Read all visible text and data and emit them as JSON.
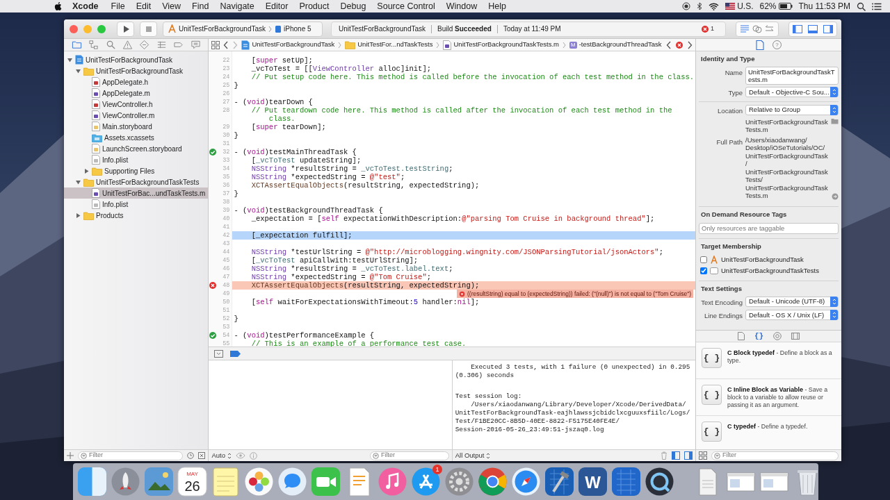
{
  "menu_bar": {
    "app": "Xcode",
    "menus": [
      "File",
      "Edit",
      "View",
      "Find",
      "Navigate",
      "Editor",
      "Product",
      "Debug",
      "Source Control",
      "Window",
      "Help"
    ],
    "input_source": "U.S.",
    "battery": "62%",
    "clock": "Thu 11:53 PM"
  },
  "toolbar": {
    "scheme": "UnitTestForBackgroundTask",
    "device": "iPhone 5",
    "activity": {
      "project": "UnitTestForBackgroundTask",
      "status": "Build **Succeeded**",
      "time": "Today at 11:49 PM",
      "errors": "1"
    },
    "editor_modes": [
      {
        "kind": "standard",
        "selected": true
      },
      {
        "kind": "assistant",
        "selected": false
      },
      {
        "kind": "version",
        "selected": false
      }
    ],
    "panels": [
      {
        "kind": "navigator",
        "on": true
      },
      {
        "kind": "debug",
        "on": true
      },
      {
        "kind": "utilities",
        "on": true
      }
    ]
  },
  "navigator": {
    "tabs": [
      {
        "kind": "folder",
        "selected": true
      },
      {
        "kind": "hierarchy",
        "selected": false
      },
      {
        "kind": "search",
        "selected": false
      },
      {
        "kind": "warning",
        "selected": false
      },
      {
        "kind": "test",
        "selected": false
      },
      {
        "kind": "debug",
        "selected": false
      },
      {
        "kind": "breakpoint",
        "selected": false
      },
      {
        "kind": "report",
        "selected": false
      }
    ],
    "tree": [
      {
        "label": "UnitTestForBackgroundTask",
        "kind": "project",
        "expanded": true,
        "selected": false,
        "children": [
          {
            "label": "UnitTestForBackgroundTask",
            "kind": "folder",
            "expanded": true,
            "selected": false,
            "children": [
              {
                "label": "AppDelegate.h",
                "kind": "header",
                "selected": false
              },
              {
                "label": "AppDelegate.m",
                "kind": "source",
                "selected": false
              },
              {
                "label": "ViewController.h",
                "kind": "header",
                "selected": false
              },
              {
                "label": "ViewController.m",
                "kind": "source",
                "selected": false
              },
              {
                "label": "Main.storyboard",
                "kind": "storyboard",
                "selected": false
              },
              {
                "label": "Assets.xcassets",
                "kind": "assets",
                "selected": false
              },
              {
                "label": "LaunchScreen.storyboard",
                "kind": "storyboard",
                "selected": false
              },
              {
                "label": "Info.plist",
                "kind": "plist",
                "selected": false
              },
              {
                "label": "Supporting Files",
                "kind": "folder",
                "expanded": false,
                "selected": false
              }
            ]
          },
          {
            "label": "UnitTestForBackgroundTaskTests",
            "kind": "folder",
            "expanded": true,
            "selected": false,
            "children": [
              {
                "label": "UnitTestForBac...undTaskTests.m",
                "kind": "source",
                "selected": true
              },
              {
                "label": "Info.plist",
                "kind": "plist",
                "selected": false
              }
            ]
          },
          {
            "label": "Products",
            "kind": "folder",
            "expanded": false,
            "selected": false
          }
        ]
      }
    ],
    "filter_placeholder": "Filter"
  },
  "jump_bar": [
    {
      "label": "UnitTestForBackgroundTask",
      "kind": "project"
    },
    {
      "label": "UnitTestFor...ndTaskTests",
      "kind": "folder"
    },
    {
      "label": "UnitTestForBackgroundTaskTests.m",
      "kind": "source"
    },
    {
      "label": "-testBackgroundThreadTask",
      "kind": "method",
      "badge": "M"
    }
  ],
  "code": [
    {
      "number": "22",
      "segments": [
        {
          "text": "    [",
          "kind": "plain"
        },
        {
          "text": "super",
          "kind": "keyword"
        },
        {
          "text": " setUp];",
          "kind": "plain"
        }
      ]
    },
    {
      "number": "23",
      "segments": [
        {
          "text": "    _vcToTest = [[",
          "kind": "plain"
        },
        {
          "text": "ViewController",
          "kind": "type"
        },
        {
          "text": " alloc]init];",
          "kind": "plain"
        }
      ]
    },
    {
      "number": "24",
      "segments": [
        {
          "text": "    // Put setup code here. This method is called before the invocation of each test method in the class.",
          "kind": "comment"
        }
      ]
    },
    {
      "number": "25",
      "segments": [
        {
          "text": "}",
          "kind": "plain"
        }
      ]
    },
    {
      "number": "26"
    },
    {
      "number": "27",
      "segments": [
        {
          "text": "- (",
          "kind": "plain"
        },
        {
          "text": "void",
          "kind": "keyword"
        },
        {
          "text": ")tearDown {",
          "kind": "plain"
        }
      ]
    },
    {
      "number": "28",
      "segments": [
        {
          "text": "    // Put teardown code here. This method is called after the invocation of each test method in the",
          "kind": "comment"
        }
      ]
    },
    {
      "segments": [
        {
          "text": "        class.",
          "kind": "comment"
        }
      ]
    },
    {
      "number": "29",
      "segments": [
        {
          "text": "    [",
          "kind": "plain"
        },
        {
          "text": "super",
          "kind": "keyword"
        },
        {
          "text": " tearDown];",
          "kind": "plain"
        }
      ]
    },
    {
      "number": "30",
      "segments": [
        {
          "text": "}",
          "kind": "plain"
        }
      ]
    },
    {
      "number": "31"
    },
    {
      "number": "32",
      "test_passed": true,
      "segments": [
        {
          "text": "- (",
          "kind": "plain"
        },
        {
          "text": "void",
          "kind": "keyword"
        },
        {
          "text": ")testMainThreadTask {",
          "kind": "plain"
        }
      ]
    },
    {
      "number": "33",
      "segments": [
        {
          "text": "    [",
          "kind": "plain"
        },
        {
          "text": "_vcToTest",
          "kind": "ivar"
        },
        {
          "text": " updateString];",
          "kind": "plain"
        }
      ]
    },
    {
      "number": "34",
      "segments": [
        {
          "text": "    NSString",
          "kind": "type"
        },
        {
          "text": " *resultString = ",
          "kind": "plain"
        },
        {
          "text": "_vcToTest.testString",
          "kind": "ivar"
        },
        {
          "text": ";",
          "kind": "plain"
        }
      ]
    },
    {
      "number": "35",
      "segments": [
        {
          "text": "    NSString",
          "kind": "type"
        },
        {
          "text": " *expectedString = ",
          "kind": "plain"
        },
        {
          "text": "@\"test\"",
          "kind": "string"
        },
        {
          "text": ";",
          "kind": "plain"
        }
      ]
    },
    {
      "number": "36",
      "segments": [
        {
          "text": "    XCTAssertEqualObjects",
          "kind": "macro"
        },
        {
          "text": "(resultString, expectedString);",
          "kind": "plain"
        }
      ]
    },
    {
      "number": "37",
      "segments": [
        {
          "text": "}",
          "kind": "plain"
        }
      ]
    },
    {
      "number": "38"
    },
    {
      "number": "39",
      "segments": [
        {
          "text": "- (",
          "kind": "plain"
        },
        {
          "text": "void",
          "kind": "keyword"
        },
        {
          "text": ")testBackgroundThreadTask {",
          "kind": "plain"
        }
      ]
    },
    {
      "number": "40",
      "segments": [
        {
          "text": "    _expectation = [",
          "kind": "plain"
        },
        {
          "text": "self",
          "kind": "keyword"
        },
        {
          "text": " expectationWithDescription:",
          "kind": "plain"
        },
        {
          "text": "@\"parsing Tom Cruise in background thread\"",
          "kind": "string"
        },
        {
          "text": "];",
          "kind": "plain"
        }
      ]
    },
    {
      "number": "41"
    },
    {
      "number": "42",
      "selected": true,
      "segments": [
        {
          "text": "    [_expectation fulfill];",
          "kind": "plain"
        }
      ]
    },
    {
      "number": "43"
    },
    {
      "number": "44",
      "segments": [
        {
          "text": "    NSString",
          "kind": "type"
        },
        {
          "text": " *testUrlString = ",
          "kind": "plain"
        },
        {
          "text": "@\"http://microblogging.wingnity.com/JSONParsingTutorial/jsonActors\"",
          "kind": "string"
        },
        {
          "text": ";",
          "kind": "plain"
        }
      ]
    },
    {
      "number": "45",
      "segments": [
        {
          "text": "    [",
          "kind": "plain"
        },
        {
          "text": "_vcToTest",
          "kind": "ivar"
        },
        {
          "text": " apiCallwith:testUrlString];",
          "kind": "plain"
        }
      ]
    },
    {
      "number": "46",
      "segments": [
        {
          "text": "    NSString",
          "kind": "type"
        },
        {
          "text": " *resultString = ",
          "kind": "plain"
        },
        {
          "text": "_vcToTest.label.text",
          "kind": "ivar"
        },
        {
          "text": ";",
          "kind": "plain"
        }
      ]
    },
    {
      "number": "47",
      "segments": [
        {
          "text": "    NSString",
          "kind": "type"
        },
        {
          "text": " *expectedString = ",
          "kind": "plain"
        },
        {
          "text": "@\"Tom Cruise\"",
          "kind": "string"
        },
        {
          "text": ";",
          "kind": "plain"
        }
      ]
    },
    {
      "number": "48",
      "test_passed": false,
      "error": true,
      "segments": [
        {
          "text": "    XCTAssertEqualObjects",
          "kind": "macro"
        },
        {
          "text": "(resultString, expectedString);",
          "kind": "plain"
        }
      ]
    },
    {
      "number": "49",
      "annotation": "((resultString) equal to (expectedString)) failed: (\"(null)\") is not equal to (\"Tom Cruise\")"
    },
    {
      "number": "50",
      "segments": [
        {
          "text": "    [",
          "kind": "plain"
        },
        {
          "text": "self",
          "kind": "keyword"
        },
        {
          "text": " waitForExpectationsWithTimeout:",
          "kind": "plain"
        },
        {
          "text": "5",
          "kind": "number"
        },
        {
          "text": " handler:",
          "kind": "plain"
        },
        {
          "text": "nil",
          "kind": "keyword"
        },
        {
          "text": "];",
          "kind": "plain"
        }
      ]
    },
    {
      "number": "51"
    },
    {
      "number": "52",
      "segments": [
        {
          "text": "}",
          "kind": "plain"
        }
      ]
    },
    {
      "number": "53"
    },
    {
      "number": "54",
      "test_passed": true,
      "segments": [
        {
          "text": "- (",
          "kind": "plain"
        },
        {
          "text": "void",
          "kind": "keyword"
        },
        {
          "text": ")testPerformanceExample {",
          "kind": "plain"
        }
      ]
    },
    {
      "number": "55",
      "segments": [
        {
          "text": "    // This is an example of a performance test case.",
          "kind": "comment"
        }
      ]
    }
  ],
  "debug": {
    "scope": "Auto",
    "filter_placeholder": "Filter",
    "output": "All Output",
    "views": [
      {
        "kind": "variables",
        "on": true
      },
      {
        "kind": "console",
        "on": true
      }
    ],
    "console": [
      "    Executed 3 tests, with 1 failure (0 unexpected) in 0.295\n(0.306) seconds",
      "Test session log:\n    /Users/xiaodanwang/Library/Developer/Xcode/DerivedData/\nUnitTestForBackgroundTask-eajhlawssjcbidclxcguuxsfiilc/Logs/\nTest/F1BE20CC-8B5D-40EE-8822-F5175E40FE4E/\nSession-2016-05-26_23:49:51-jszaq0.log"
    ]
  },
  "inspector": {
    "tabs": [
      {
        "kind": "file",
        "selected": true
      },
      {
        "kind": "help",
        "label": "?",
        "selected": false
      }
    ],
    "identity": {
      "title": "Identity and Type",
      "name_label": "Name",
      "name": "UnitTestForBackgroundTaskTests.m",
      "type_label": "Type",
      "type": "Default - Objective-C Sou...",
      "location_label": "Location",
      "location": "Relative to Group",
      "file_name": "UnitTestForBackgroundTaskTests.m",
      "full_path_label": "Full Path",
      "full_path": "/Users/xiaodanwang/\nDesktop/iOSeTutorials/OC/\nUnitTestForBackgroundTask\n/\nUnitTestForBackgroundTask\nTests/\nUnitTestForBackgroundTask\nTests.m"
    },
    "tags": {
      "title": "On Demand Resource Tags",
      "placeholder": "Only resources are taggable"
    },
    "membership": {
      "title": "Target Membership",
      "targets": [
        {
          "label": "UnitTestForBackgroundTask",
          "kind": "app",
          "checked": false
        },
        {
          "label": "UnitTestForBackgroundTaskTests",
          "kind": "tests",
          "checked": true
        }
      ]
    },
    "text_settings": {
      "title": "Text Settings",
      "encoding_label": "Text Encoding",
      "encoding": "Default - Unicode (UTF-8)",
      "endings_label": "Line Endings",
      "endings": "Default - OS X / Unix (LF)"
    }
  },
  "library": {
    "tabs": [
      {
        "kind": "file",
        "selected": false
      },
      {
        "kind": "code",
        "label": "{}",
        "selected": true
      },
      {
        "kind": "object",
        "selected": false
      },
      {
        "kind": "media",
        "selected": false
      }
    ],
    "items": [
      {
        "glyph": "{ }",
        "text": "**C Block typedef** - Define a block as a type."
      },
      {
        "glyph": "{ }",
        "text": "**C Inline Block as Variable** - Save a block to a variable to allow reuse or passing it as an argument."
      },
      {
        "glyph": "{ }",
        "text": "**C typedef** - Define a typedef."
      }
    ],
    "filter_placeholder": "Filter"
  },
  "dock": [
    {
      "kind": "finder"
    },
    {
      "kind": "launchpad"
    },
    {
      "kind": "preview"
    },
    {
      "kind": "calendar",
      "month": "MAY",
      "day": "26"
    },
    {
      "kind": "notes"
    },
    {
      "kind": "photos"
    },
    {
      "kind": "messages"
    },
    {
      "kind": "facetime"
    },
    {
      "kind": "pages"
    },
    {
      "kind": "music"
    },
    {
      "kind": "appstore",
      "badge": "1"
    },
    {
      "kind": "settings"
    },
    {
      "kind": "chrome"
    },
    {
      "kind": "safari"
    },
    {
      "kind": "xcode"
    },
    {
      "kind": "word",
      "label": "W"
    },
    {
      "kind": "blueprint"
    },
    {
      "kind": "quicktime"
    },
    {
      "kind": "separator"
    },
    {
      "kind": "file"
    },
    {
      "kind": "window"
    },
    {
      "kind": "window"
    },
    {
      "kind": "trash"
    }
  ]
}
